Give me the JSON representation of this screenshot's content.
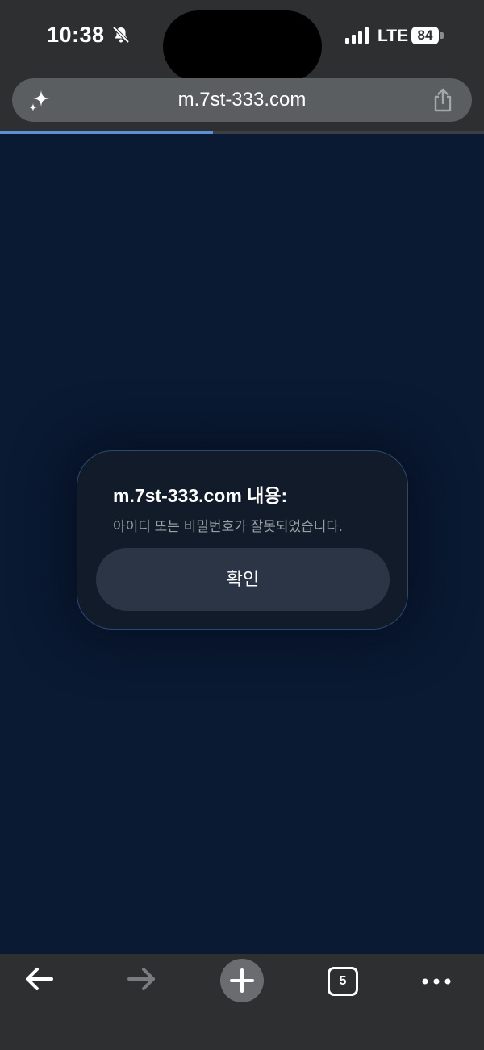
{
  "status_bar": {
    "time": "10:38",
    "network": "LTE",
    "battery": "84"
  },
  "browser": {
    "url": "m.7st-333.com",
    "load_progress": 0.44,
    "tab_count": "5"
  },
  "dialog": {
    "title": "m.7st-333.com 내용:",
    "message": "아이디 또는 비밀번호가 잘못되었습니다.",
    "confirm_label": "확인"
  },
  "icons": {
    "bell": "bell-slash-icon",
    "signal": "cellular-signal-icon",
    "sparkle": "sparkle-icon",
    "share": "share-icon",
    "back": "arrow-left-icon",
    "forward": "arrow-right-icon",
    "new_tab": "plus-icon",
    "more": "ellipsis-icon"
  },
  "colors": {
    "page_background": "#0a1a33",
    "chrome": "#2d2f31",
    "progress": "#5b8fd6",
    "dialog_background": "#111b29",
    "dialog_button": "#2b3545"
  }
}
